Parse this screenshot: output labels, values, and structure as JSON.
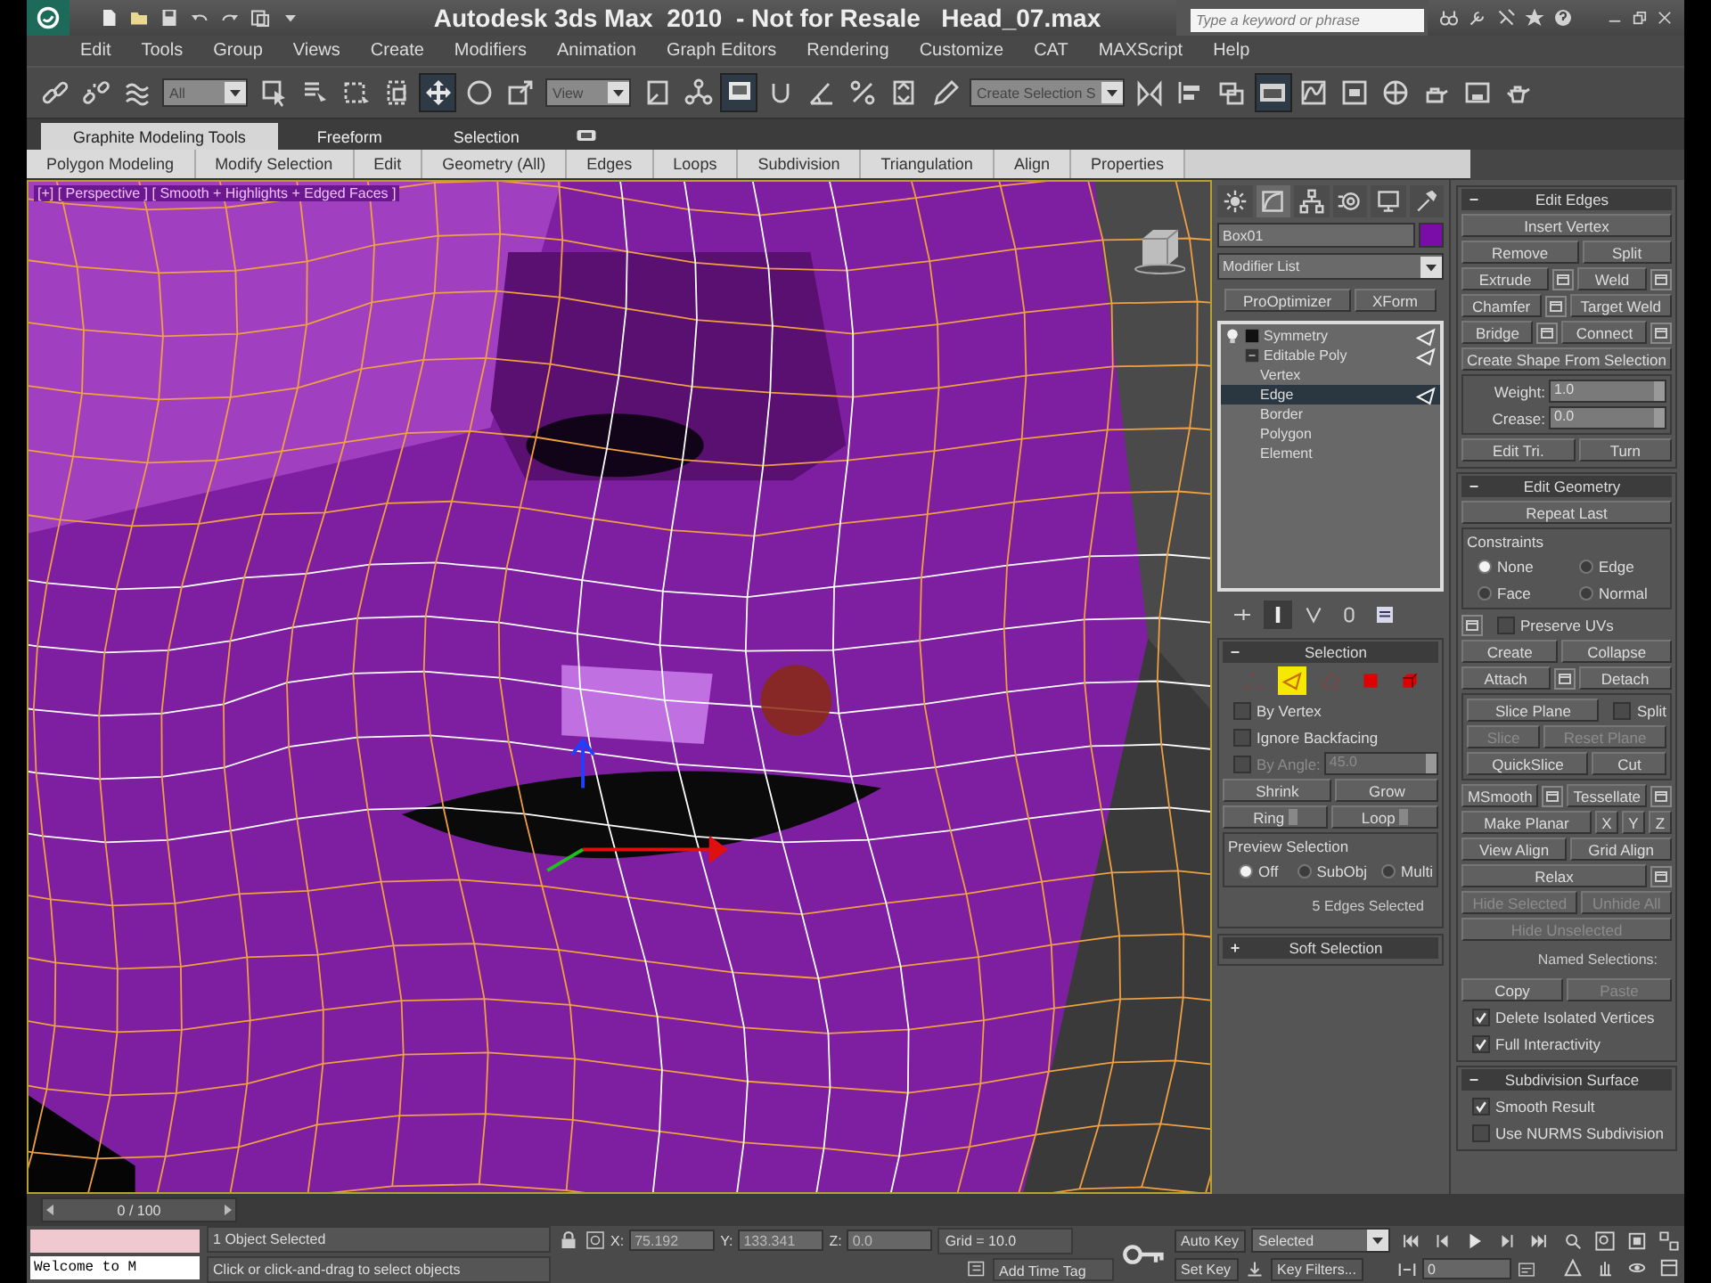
{
  "title_bar": {
    "title": "Autodesk 3ds Max  2010  - Not for Resale   Head_07.max",
    "quick_access": [
      {
        "kind": "new"
      },
      {
        "kind": "open"
      },
      {
        "kind": "save"
      },
      {
        "kind": "undo"
      },
      {
        "kind": "redo"
      },
      {
        "kind": "project"
      },
      {
        "kind": "caret"
      }
    ],
    "search": {
      "placeholder": "Type a keyword or phrase"
    },
    "tools": [
      {
        "kind": "binoculars"
      },
      {
        "kind": "wrench"
      },
      {
        "kind": "satellite"
      },
      {
        "kind": "star"
      },
      {
        "kind": "help"
      }
    ],
    "window_controls": [
      {
        "kind": "minimize"
      },
      {
        "kind": "restore"
      },
      {
        "kind": "close"
      }
    ]
  },
  "menu": [
    "Edit",
    "Tools",
    "Group",
    "Views",
    "Create",
    "Modifiers",
    "Animation",
    "Graph Editors",
    "Rendering",
    "Customize",
    "CAT",
    "MAXScript",
    "Help"
  ],
  "toolbar": [
    {
      "kind": "link",
      "pressed": false
    },
    {
      "kind": "unlink",
      "pressed": false
    },
    {
      "kind": "wave",
      "pressed": false
    },
    {
      "kind": "dropdown",
      "value": "All"
    },
    {
      "kind": "select",
      "pressed": false
    },
    {
      "kind": "list",
      "pressed": false
    },
    {
      "kind": "region",
      "pressed": false
    },
    {
      "kind": "crossing",
      "pressed": false
    },
    {
      "kind": "move",
      "pressed": true
    },
    {
      "kind": "rotate",
      "pressed": false
    },
    {
      "kind": "scale",
      "pressed": false
    },
    {
      "kind": "dropdown",
      "value": "View"
    },
    {
      "kind": "pivot",
      "pressed": false
    },
    {
      "kind": "nodes",
      "pressed": false
    },
    {
      "kind": "screen",
      "pressed": true
    },
    {
      "kind": "snap",
      "pressed": false
    },
    {
      "kind": "angle",
      "pressed": false
    },
    {
      "kind": "percent",
      "pressed": false
    },
    {
      "kind": "spinner",
      "pressed": false
    },
    {
      "kind": "pencil",
      "pressed": false
    },
    {
      "kind": "dropdown",
      "value": "Create Selection S"
    },
    {
      "kind": "mirror",
      "pressed": false
    },
    {
      "kind": "align",
      "pressed": false
    },
    {
      "kind": "layers",
      "pressed": false
    },
    {
      "kind": "ribbon",
      "pressed": true
    },
    {
      "kind": "curve",
      "pressed": false
    },
    {
      "kind": "schematic",
      "pressed": false
    },
    {
      "kind": "material",
      "pressed": false
    },
    {
      "kind": "render-setup",
      "pressed": false
    },
    {
      "kind": "render-frame",
      "pressed": false
    },
    {
      "kind": "teapot",
      "pressed": false
    }
  ],
  "ribbon": {
    "tabs": [
      {
        "label": "Graphite Modeling Tools",
        "selected": true
      },
      {
        "label": "Freeform",
        "selected": false
      },
      {
        "label": "Selection",
        "selected": false
      }
    ],
    "panels": [
      "Polygon Modeling",
      "Modify Selection",
      "Edit",
      "Geometry (All)",
      "Edges",
      "Loops",
      "Subdivision",
      "Triangulation",
      "Align",
      "Properties"
    ]
  },
  "viewport": {
    "label": "[+] [ Perspective ] [ Smooth + Highlights + Edged Faces ]"
  },
  "command_panel": {
    "tabs": [
      {
        "kind": "create",
        "selected": false
      },
      {
        "kind": "modify",
        "selected": true
      },
      {
        "kind": "hierarchy",
        "selected": false
      },
      {
        "kind": "motion",
        "selected": false
      },
      {
        "kind": "display",
        "selected": false
      },
      {
        "kind": "utilities",
        "selected": false
      }
    ],
    "object_name": "Box01",
    "modifier_list": "Modifier List",
    "modifier_buttons": [
      "ProOptimizer",
      "XForm"
    ],
    "stack": [
      {
        "kind": "modifier",
        "label": "Symmetry",
        "selected": false,
        "expanded": false
      },
      {
        "kind": "object",
        "label": "Editable Poly",
        "selected": false,
        "expanded": true,
        "children": [
          {
            "label": "Vertex",
            "selected": false
          },
          {
            "label": "Edge",
            "selected": true
          },
          {
            "label": "Border",
            "selected": false
          },
          {
            "label": "Polygon",
            "selected": false
          },
          {
            "label": "Element",
            "selected": false
          }
        ]
      }
    ],
    "stack_tools": [
      {
        "kind": "pin",
        "pressed": false
      },
      {
        "kind": "end-result",
        "pressed": true
      },
      {
        "kind": "unique",
        "pressed": false
      },
      {
        "kind": "remove",
        "pressed": false
      },
      {
        "kind": "configure",
        "pressed": false
      }
    ],
    "rollouts_left": [
      {
        "title": "Selection",
        "expanded": true,
        "rows": [
          {
            "kind": "subobjects",
            "items": [
              {
                "kind": "vertex",
                "selected": false
              },
              {
                "kind": "edge",
                "selected": true
              },
              {
                "kind": "border",
                "selected": false
              },
              {
                "kind": "polygon",
                "selected": false
              },
              {
                "kind": "element",
                "selected": false
              }
            ]
          },
          {
            "kind": "row",
            "controls": [
              {
                "kind": "checkbox",
                "label": "By Vertex",
                "checked": false,
                "disabled": false
              }
            ]
          },
          {
            "kind": "row",
            "controls": [
              {
                "kind": "checkbox",
                "label": "Ignore Backfacing",
                "checked": false,
                "disabled": false
              }
            ]
          },
          {
            "kind": "row",
            "controls": [
              {
                "kind": "checkbox",
                "label": "By Angle:",
                "checked": false,
                "disabled": true
              },
              {
                "kind": "spinner",
                "value": "45.0",
                "disabled": true
              }
            ]
          },
          {
            "kind": "row",
            "controls": [
              {
                "kind": "button",
                "label": "Shrink",
                "disabled": false
              },
              {
                "kind": "button",
                "label": "Grow",
                "disabled": false
              }
            ]
          },
          {
            "kind": "row",
            "controls": [
              {
                "kind": "button",
                "label": "Ring",
                "disabled": false,
                "stepper": true
              },
              {
                "kind": "button",
                "label": "Loop",
                "disabled": false,
                "stepper": true
              }
            ]
          },
          {
            "kind": "group",
            "title": "Preview Selection",
            "rows": [
              {
                "kind": "row",
                "controls": [
                  {
                    "kind": "radio",
                    "label": "Off",
                    "selected": true
                  },
                  {
                    "kind": "radio",
                    "label": "SubObj",
                    "selected": false
                  },
                  {
                    "kind": "radio",
                    "label": "Multi",
                    "selected": false
                  }
                ]
              }
            ]
          },
          {
            "kind": "note",
            "text": "5 Edges Selected"
          }
        ]
      },
      {
        "title": "Soft Selection",
        "expanded": false
      }
    ],
    "rollouts_right": [
      {
        "title": "Edit Edges",
        "expanded": true,
        "rows": [
          {
            "kind": "row",
            "controls": [
              {
                "kind": "button",
                "label": "Insert Vertex",
                "disabled": false
              }
            ]
          },
          {
            "kind": "row",
            "controls": [
              {
                "kind": "button",
                "label": "Remove",
                "disabled": false
              },
              {
                "kind": "button",
                "label": "Split",
                "disabled": false
              }
            ]
          },
          {
            "kind": "row",
            "controls": [
              {
                "kind": "button",
                "label": "Extrude",
                "disabled": false,
                "settings": true
              },
              {
                "kind": "button",
                "label": "Weld",
                "disabled": false,
                "settings": true
              }
            ]
          },
          {
            "kind": "row",
            "controls": [
              {
                "kind": "button",
                "label": "Chamfer",
                "disabled": false,
                "settings": true
              },
              {
                "kind": "button",
                "label": "Target Weld",
                "disabled": false
              }
            ]
          },
          {
            "kind": "row",
            "controls": [
              {
                "kind": "button",
                "label": "Bridge",
                "disabled": false,
                "settings": true
              },
              {
                "kind": "button",
                "label": "Connect",
                "disabled": false,
                "settings": true
              }
            ]
          },
          {
            "kind": "row",
            "controls": [
              {
                "kind": "button",
                "label": "Create Shape From Selection",
                "disabled": false
              }
            ]
          },
          {
            "kind": "group",
            "rows": [
              {
                "kind": "row",
                "controls": [
                  {
                    "kind": "spinner",
                    "label": "Weight:",
                    "value": "1.0",
                    "disabled": false
                  }
                ]
              },
              {
                "kind": "row",
                "controls": [
                  {
                    "kind": "spinner",
                    "label": "Crease:",
                    "value": "0.0",
                    "disabled": false
                  }
                ]
              }
            ]
          },
          {
            "kind": "row",
            "controls": [
              {
                "kind": "button",
                "label": "Edit Tri.",
                "disabled": false
              },
              {
                "kind": "button",
                "label": "Turn",
                "disabled": false
              }
            ]
          }
        ]
      },
      {
        "title": "Edit Geometry",
        "expanded": true,
        "rows": [
          {
            "kind": "row",
            "controls": [
              {
                "kind": "button",
                "label": "Repeat Last",
                "disabled": false
              }
            ]
          },
          {
            "kind": "group",
            "title": "Constraints",
            "rows": [
              {
                "kind": "row",
                "controls": [
                  {
                    "kind": "radio",
                    "label": "None",
                    "selected": true
                  },
                  {
                    "kind": "radio",
                    "label": "Edge",
                    "selected": false
                  }
                ]
              },
              {
                "kind": "row",
                "controls": [
                  {
                    "kind": "radio",
                    "label": "Face",
                    "selected": false
                  },
                  {
                    "kind": "radio",
                    "label": "Normal",
                    "selected": false
                  }
                ]
              }
            ]
          },
          {
            "kind": "row",
            "controls": [
              {
                "kind": "checkbox",
                "label": "Preserve UVs",
                "checked": false,
                "disabled": false,
                "settings": true
              }
            ]
          },
          {
            "kind": "row",
            "controls": [
              {
                "kind": "button",
                "label": "Create",
                "disabled": false
              },
              {
                "kind": "button",
                "label": "Collapse",
                "disabled": false
              }
            ]
          },
          {
            "kind": "row",
            "controls": [
              {
                "kind": "button",
                "label": "Attach",
                "disabled": false,
                "settings": true
              },
              {
                "kind": "button",
                "label": "Detach",
                "disabled": false
              }
            ]
          },
          {
            "kind": "group",
            "rows": [
              {
                "kind": "row",
                "controls": [
                  {
                    "kind": "button",
                    "label": "Slice Plane",
                    "disabled": false
                  },
                  {
                    "kind": "checkbox",
                    "label": "Split",
                    "checked": false,
                    "disabled": false
                  }
                ]
              },
              {
                "kind": "row",
                "controls": [
                  {
                    "kind": "button",
                    "label": "Slice",
                    "disabled": true
                  },
                  {
                    "kind": "button",
                    "label": "Reset Plane",
                    "disabled": true
                  }
                ]
              },
              {
                "kind": "row",
                "controls": [
                  {
                    "kind": "button",
                    "label": "QuickSlice",
                    "disabled": false
                  },
                  {
                    "kind": "button",
                    "label": "Cut",
                    "disabled": false
                  }
                ]
              }
            ]
          },
          {
            "kind": "row",
            "controls": [
              {
                "kind": "button",
                "label": "MSmooth",
                "disabled": false,
                "settings": true
              },
              {
                "kind": "button",
                "label": "Tessellate",
                "disabled": false,
                "settings": true
              }
            ]
          },
          {
            "kind": "row",
            "controls": [
              {
                "kind": "button",
                "label": "Make Planar",
                "disabled": false
              },
              {
                "kind": "button",
                "label": "X",
                "disabled": false
              },
              {
                "kind": "button",
                "label": "Y",
                "disabled": false
              },
              {
                "kind": "button",
                "label": "Z",
                "disabled": false
              }
            ]
          },
          {
            "kind": "row",
            "controls": [
              {
                "kind": "button",
                "label": "View Align",
                "disabled": false
              },
              {
                "kind": "button",
                "label": "Grid Align",
                "disabled": false
              }
            ]
          },
          {
            "kind": "row",
            "controls": [
              {
                "kind": "button",
                "label": "Relax",
                "disabled": false,
                "settings": true
              }
            ]
          },
          {
            "kind": "row",
            "controls": [
              {
                "kind": "button",
                "label": "Hide Selected",
                "disabled": true
              },
              {
                "kind": "button",
                "label": "Unhide All",
                "disabled": true
              }
            ]
          },
          {
            "kind": "row",
            "controls": [
              {
                "kind": "button",
                "label": "Hide Unselected",
                "disabled": true
              }
            ]
          },
          {
            "kind": "note",
            "text": "Named Selections:"
          },
          {
            "kind": "row",
            "controls": [
              {
                "kind": "button",
                "label": "Copy",
                "disabled": false
              },
              {
                "kind": "button",
                "label": "Paste",
                "disabled": true
              }
            ]
          },
          {
            "kind": "row",
            "controls": [
              {
                "kind": "checkbox",
                "label": "Delete Isolated Vertices",
                "checked": true,
                "disabled": false
              }
            ]
          },
          {
            "kind": "row",
            "controls": [
              {
                "kind": "checkbox",
                "label": "Full Interactivity",
                "checked": true,
                "disabled": false
              }
            ]
          }
        ]
      },
      {
        "title": "Subdivision Surface",
        "expanded": true,
        "rows": [
          {
            "kind": "row",
            "controls": [
              {
                "kind": "checkbox",
                "label": "Smooth Result",
                "checked": true,
                "disabled": false
              }
            ]
          },
          {
            "kind": "row",
            "controls": [
              {
                "kind": "checkbox",
                "label": "Use NURMS Subdivision",
                "checked": false,
                "disabled": false
              }
            ]
          }
        ]
      }
    ]
  },
  "time_slider": {
    "label": "0 / 100",
    "level": 0
  },
  "status_bar": {
    "listener_output": "Welcome to M",
    "selection_info": "1 Object Selected",
    "prompt": "Click or click-and-drag to select objects",
    "coords": [
      {
        "axis": "X:",
        "value": "75.192"
      },
      {
        "axis": "Y:",
        "value": "133.341"
      },
      {
        "axis": "Z:",
        "value": "0.0"
      }
    ],
    "grid": "Grid = 10.0",
    "time_tag": "Add Time Tag",
    "auto_key": "Auto Key",
    "key_mode": "Selected",
    "set_key": "Set Key",
    "key_filters": "Key Filters...",
    "frame": "0",
    "playback": [
      {
        "kind": "go-start"
      },
      {
        "kind": "prev-frame"
      },
      {
        "kind": "play"
      },
      {
        "kind": "next-frame"
      },
      {
        "kind": "go-end"
      }
    ],
    "nav": [
      {
        "kind": "zoom"
      },
      {
        "kind": "zoom-all"
      },
      {
        "kind": "zoom-extents"
      },
      {
        "kind": "zoom-extents-all"
      },
      {
        "kind": "fov"
      },
      {
        "kind": "pan"
      },
      {
        "kind": "orbit"
      },
      {
        "kind": "max-toggle"
      }
    ]
  }
}
